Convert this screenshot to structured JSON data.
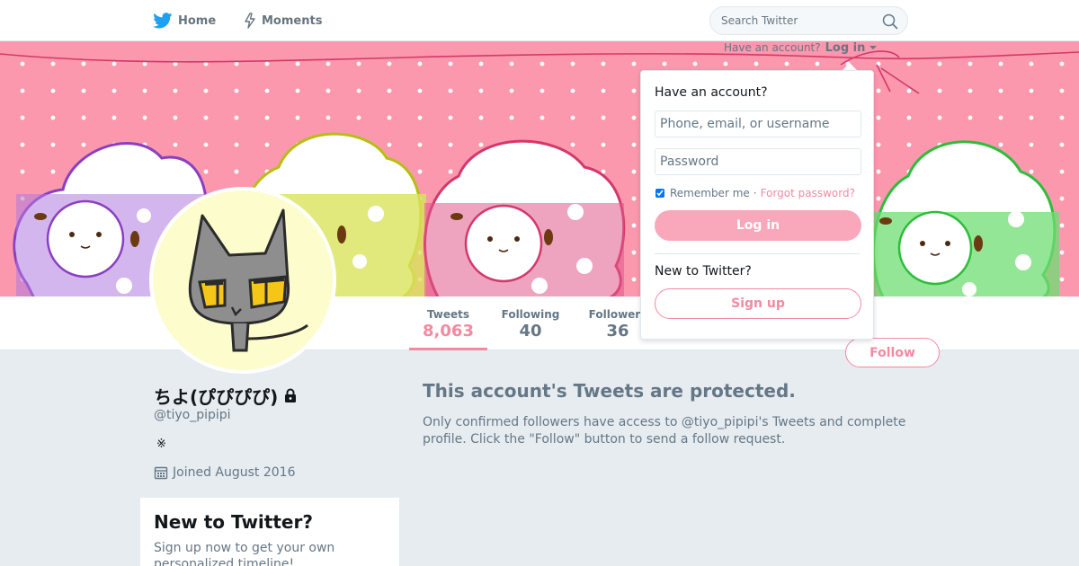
{
  "nav": {
    "home_label": "Home",
    "moments_label": "Moments"
  },
  "search": {
    "placeholder": "Search Twitter"
  },
  "header_login": {
    "prompt": "Have an account?",
    "link": "Log in"
  },
  "stats": [
    {
      "label": "Tweets",
      "value": "8,063",
      "active": true
    },
    {
      "label": "Following",
      "value": "40",
      "active": false
    },
    {
      "label": "Followers",
      "value": "36",
      "active": false
    }
  ],
  "follow_button": "Follow",
  "profile": {
    "name": "ちよ(ぴぴぴぴ)",
    "handle": "@tiyo_pipipi",
    "bio": "※",
    "joined": "Joined August 2016"
  },
  "signup_card": {
    "title": "New to Twitter?",
    "text": "Sign up now to get your own personalized timeline!"
  },
  "protected": {
    "title": "This account's Tweets are protected.",
    "text": "Only confirmed followers have access to @tiyo_pipipi's Tweets and complete profile. Click the \"Follow\" button to send a follow request."
  },
  "login_dropdown": {
    "title": "Have an account?",
    "username_placeholder": "Phone, email, or username",
    "password_placeholder": "Password",
    "remember_label": "Remember me",
    "separator": "·",
    "forgot_label": "Forgot password?",
    "login_button": "Log in",
    "new_label": "New to Twitter?",
    "signup_button": "Sign up"
  },
  "colors": {
    "accent": "#f28aa1",
    "banner_bg": "#fb98ad",
    "twitter_blue": "#1da1f2"
  }
}
